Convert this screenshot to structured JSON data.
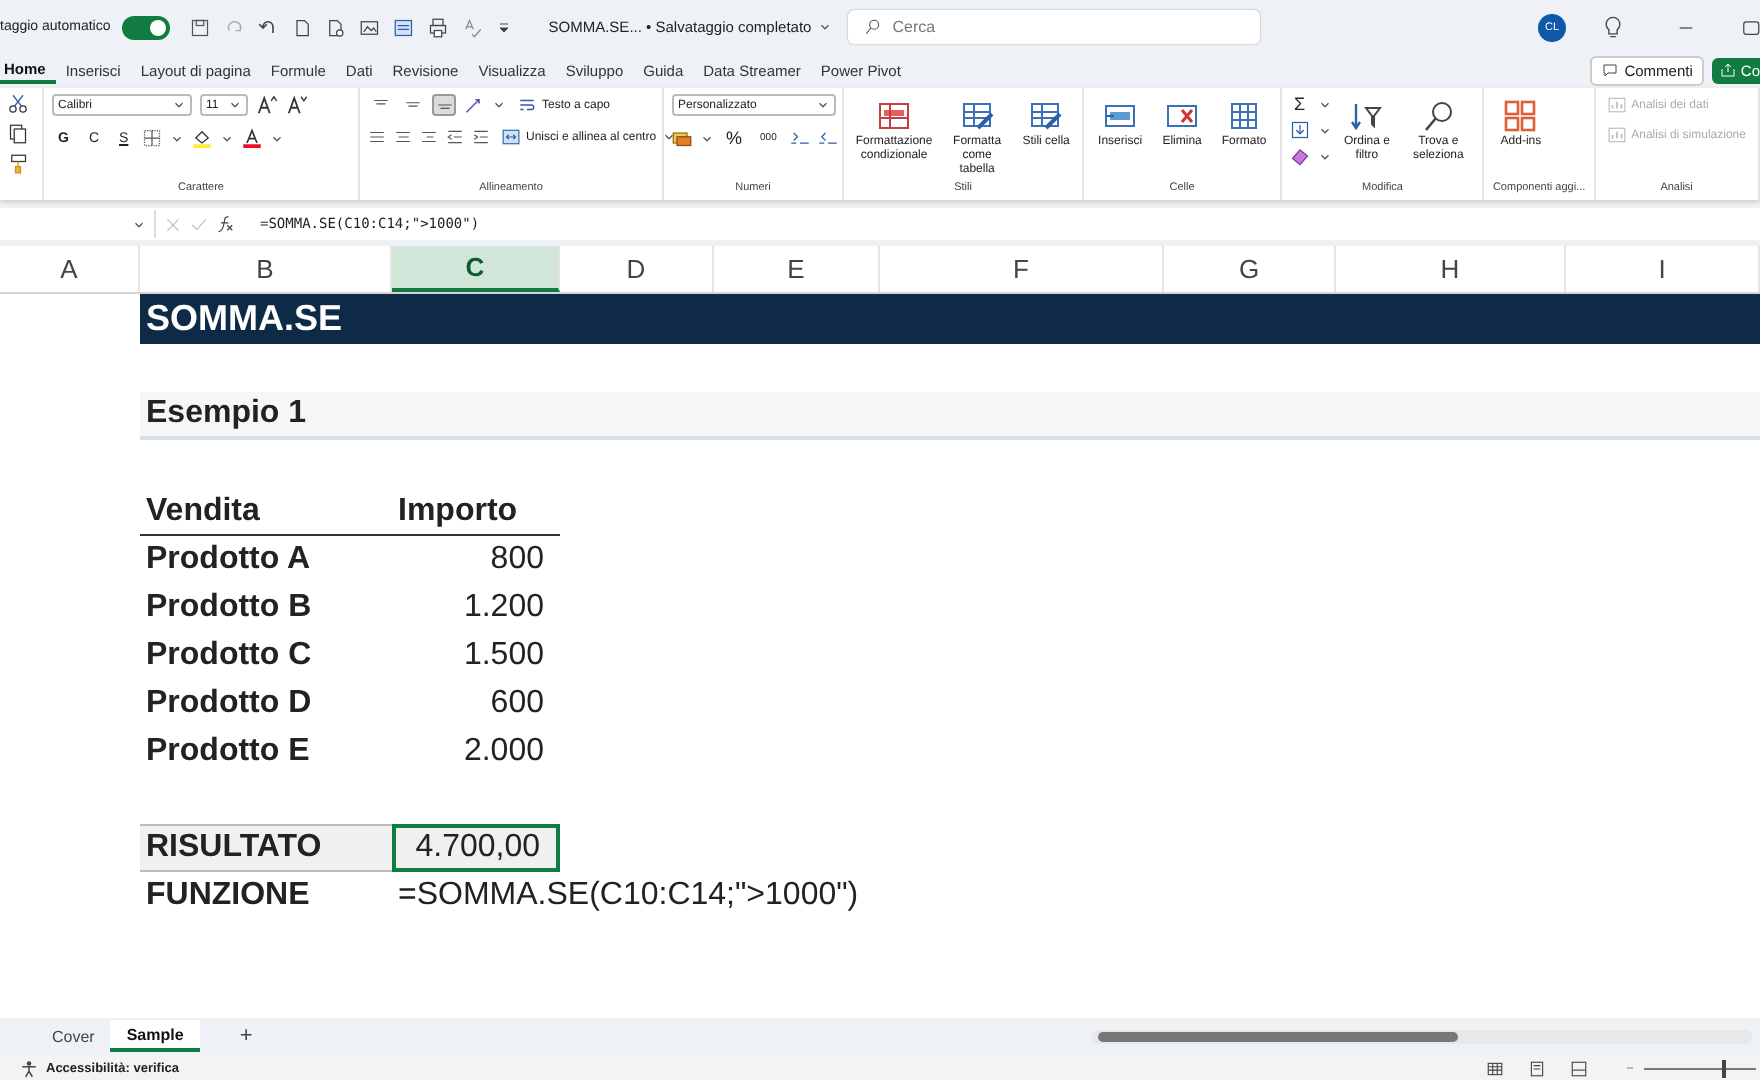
{
  "title_bar": {
    "autosave_label": "taggio automatico",
    "autosave_on": true,
    "file_title": "SOMMA.SE... • Salvataggio completato",
    "search_placeholder": "Cerca",
    "avatar_initials": "CL"
  },
  "menu_tabs": [
    {
      "label": "Home",
      "selected": true
    },
    {
      "label": "Inserisci",
      "selected": false
    },
    {
      "label": "Layout di pagina",
      "selected": false
    },
    {
      "label": "Formule",
      "selected": false
    },
    {
      "label": "Dati",
      "selected": false
    },
    {
      "label": "Revisione",
      "selected": false
    },
    {
      "label": "Visualizza",
      "selected": false
    },
    {
      "label": "Sviluppo",
      "selected": false
    },
    {
      "label": "Guida",
      "selected": false
    },
    {
      "label": "Data Streamer",
      "selected": false
    },
    {
      "label": "Power Pivot",
      "selected": false
    }
  ],
  "comments_button": "Commenti",
  "share_button": "Co",
  "ribbon": [
    {
      "kind": "clipboard"
    },
    {
      "kind": "font",
      "label": "Carattere",
      "font_name": "Calibri",
      "font_size": "11",
      "style_buttons": [
        "G",
        "C",
        "S"
      ]
    },
    {
      "kind": "alignment",
      "label": "Allineamento",
      "vertical_align": [
        {
          "selected": false
        },
        {
          "selected": false
        },
        {
          "selected": true
        }
      ],
      "wrap_button": "Testo a capo",
      "merge_button": "Unisci e allinea al centro"
    },
    {
      "kind": "number",
      "label": "Numeri",
      "format": "Personalizzato",
      "percent_symbol": "%",
      "thousands_symbol": "000"
    },
    {
      "kind": "large",
      "label": "Stili",
      "items": [
        {
          "label": "Formattazione condizionale"
        },
        {
          "label": "Formatta come tabella"
        },
        {
          "label": "Stili cella"
        }
      ]
    },
    {
      "kind": "large",
      "label": "Celle",
      "items": [
        {
          "label": "Inserisci"
        },
        {
          "label": "Elimina"
        },
        {
          "label": "Formato"
        }
      ]
    },
    {
      "kind": "edit",
      "label": "Modifica",
      "sum_symbol": "Σ",
      "items": [
        {
          "label": "Ordina e filtro"
        },
        {
          "label": "Trova e seleziona"
        }
      ]
    },
    {
      "kind": "large",
      "label": "Componenti aggi...",
      "items": [
        {
          "label": "Add-ins"
        }
      ]
    },
    {
      "kind": "list",
      "label": "Analisi",
      "items": [
        {
          "label": "Analisi dei dati",
          "disabled": true
        },
        {
          "label": "Analisi di simulazione",
          "disabled": true
        }
      ]
    }
  ],
  "formula_bar": {
    "formula": "=SOMMA.SE(C10:C14;\">1000\")"
  },
  "sheet": {
    "columns": [
      {
        "letter": "A",
        "selected": false
      },
      {
        "letter": "B",
        "selected": false
      },
      {
        "letter": "C",
        "selected": true
      },
      {
        "letter": "D",
        "selected": false
      },
      {
        "letter": "E",
        "selected": false
      },
      {
        "letter": "F",
        "selected": false
      },
      {
        "letter": "G",
        "selected": false
      },
      {
        "letter": "H",
        "selected": false
      },
      {
        "letter": "I",
        "selected": false
      }
    ],
    "title": "SOMMA.SE",
    "subtitle": "Esempio 1",
    "headers": [
      "Vendita",
      "Importo"
    ],
    "rows": [
      {
        "product": "Prodotto A",
        "amount": "800"
      },
      {
        "product": "Prodotto B",
        "amount": "1.200"
      },
      {
        "product": "Prodotto C",
        "amount": "1.500"
      },
      {
        "product": "Prodotto D",
        "amount": "600"
      },
      {
        "product": "Prodotto E",
        "amount": "2.000"
      }
    ],
    "result": {
      "label": "RISULTATO",
      "value": "4.700,00",
      "selected": true
    },
    "function": {
      "label": "FUNZIONE",
      "formula": "=SOMMA.SE(C10:C14;\">1000\")"
    }
  },
  "sheet_tabs": [
    {
      "label": "Cover",
      "selected": false
    },
    {
      "label": "Sample",
      "selected": true
    }
  ],
  "add_sheet": "+",
  "status_bar": {
    "accessibility": "Accessibilità: verifica",
    "zoom_slider": {
      "level": 0.7
    }
  }
}
